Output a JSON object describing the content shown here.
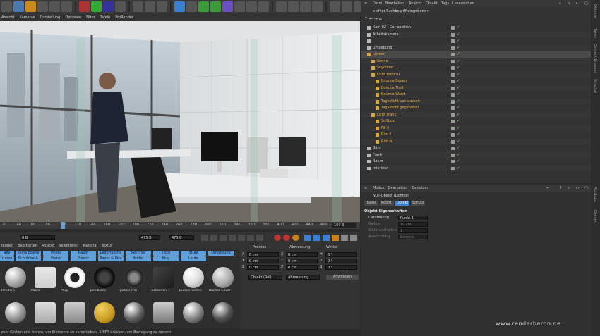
{
  "menubar": [
    "Ansicht",
    "Kameras",
    "Darstellung",
    "Optionen",
    "Filter",
    "Tafeln",
    "ProRender"
  ],
  "timeline": {
    "ticks": [
      "20",
      "40",
      "60",
      "80",
      "100",
      "120",
      "140",
      "160",
      "180",
      "200",
      "220",
      "240",
      "260",
      "280",
      "300",
      "320",
      "340",
      "360",
      "380",
      "400",
      "420",
      "440",
      "460"
    ],
    "frame_end": "100 B",
    "playhead_frame": "90"
  },
  "transport": {
    "start": "0 B",
    "current": "475 B",
    "end": "475 B"
  },
  "material_menu": [
    "zeugen",
    "Bearbeiten",
    "Ansicht",
    "Selektieren",
    "Material",
    "Textur"
  ],
  "material_tags": [
    [
      "alle",
      "Keine Ebene",
      "Props",
      "Raum",
      "Ledertasche",
      "Rechner",
      "Tisch",
      "Stuhl",
      "Umgebung"
    ],
    [
      "ruppe",
      "Schränke & Co",
      "Frank",
      "Plastic",
      "Paper & Pics",
      "Metal",
      "Mug",
      "Leute"
    ]
  ],
  "materials_row1": [
    "Renderp",
    "Paper",
    "Mug",
    "pen black",
    "pens silver",
    "Fussboden",
    "Bücher Seiten",
    "Bücher Cover"
  ],
  "coord": {
    "headers": [
      "Position",
      "Abmessung",
      "Winkel"
    ],
    "rows": [
      {
        "axis": "X",
        "pos": "0 cm",
        "dim": "0 cm",
        "rot_axis": "H",
        "rot": "0 °"
      },
      {
        "axis": "Y",
        "pos": "0 cm",
        "dim": "0 cm",
        "rot_axis": "P",
        "rot": "0 °"
      },
      {
        "axis": "Z",
        "pos": "0 cm",
        "dim": "0 cm",
        "rot_axis": "B",
        "rot": "0 °"
      }
    ],
    "mode": "Objekt (Rel)",
    "size_mode": "Abmessung",
    "apply": "Anwenden"
  },
  "status": "zen: Klicken und ziehen, um Elemente zu verschieben. SHIFT drücken, um Bewegung zu rastern.",
  "objmgr": {
    "menu": [
      "Datei",
      "Bearbeiten",
      "Ansicht",
      "Objekt",
      "Tags",
      "Lesezeichen"
    ],
    "search_placeholder": "<<Hier Suchbegriff eingeben>>",
    "rows": [
      {
        "label": "Kam 02 - Car position",
        "indent": 0
      },
      {
        "label": "Arbeitskamera",
        "indent": 0
      },
      {
        "label": "",
        "indent": 0
      },
      {
        "label": "Umgebung",
        "indent": 0
      },
      {
        "label": "Lichter",
        "indent": 0
      },
      {
        "label": "Sonne",
        "indent": 1
      },
      {
        "label": "Skydome",
        "indent": 1
      },
      {
        "label": "Licht Büro 01",
        "indent": 1
      },
      {
        "label": "Bounce Boden",
        "indent": 2
      },
      {
        "label": "Bounce Tisch",
        "indent": 2
      },
      {
        "label": "Bounce Wand",
        "indent": 2
      },
      {
        "label": "Tageslicht von aussen",
        "indent": 2
      },
      {
        "label": "Tageslicht gegenüber",
        "indent": 2
      },
      {
        "label": "Licht Frank",
        "indent": 1
      },
      {
        "label": "Softbox",
        "indent": 2
      },
      {
        "label": "Fill li",
        "indent": 2
      },
      {
        "label": "Rim li",
        "indent": 2
      },
      {
        "label": "Rim re",
        "indent": 2
      },
      {
        "label": "Büro",
        "indent": 0
      },
      {
        "label": "Frank",
        "indent": 0
      },
      {
        "label": "Raum",
        "indent": 0
      },
      {
        "label": "Interieur",
        "indent": 0
      }
    ]
  },
  "attr": {
    "menu": [
      "Modus",
      "Bearbeiten",
      "Benutzer"
    ],
    "object_title": "Null-Objekt [Lichter]",
    "tabs": [
      "Basis",
      "Koord.",
      "Objekt",
      "Schutz"
    ],
    "active_tab": "Objekt",
    "section": "Objekt-Eigenschaften",
    "props": [
      {
        "label": "Darstellung",
        "value": "Punkt 1"
      },
      {
        "label": "Radius",
        "value": "10 cm"
      },
      {
        "label": "Seitenverhältnis",
        "value": "1"
      },
      {
        "label": "Ausrichtung",
        "value": "Kamera"
      }
    ]
  },
  "side_tabs": [
    "Objekte",
    "Takes",
    "Content Browser",
    "Struktur",
    "Attribute",
    "Ebenen"
  ],
  "watermark": "www.renderbaron.de"
}
